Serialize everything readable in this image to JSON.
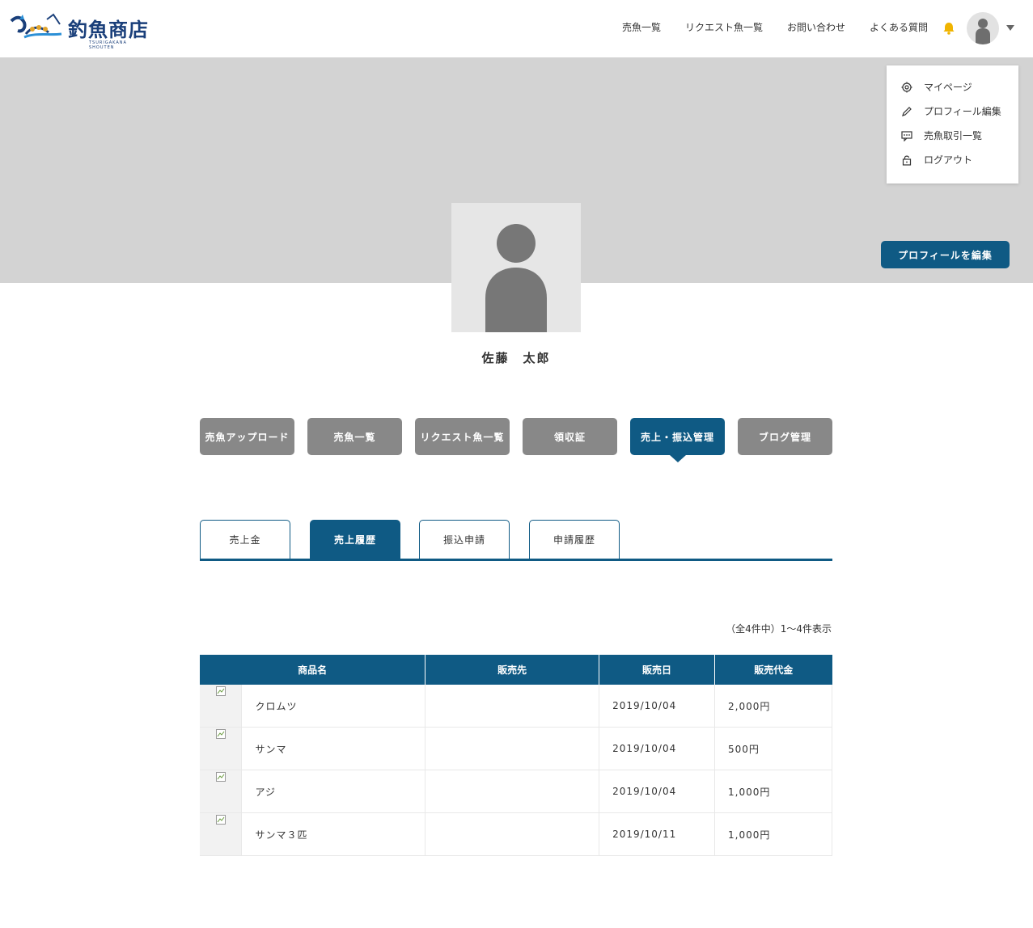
{
  "header": {
    "logo_text": "釣魚商店",
    "logo_sub": "TSURIGAKANA SHOUTEN",
    "nav": [
      "売魚一覧",
      "リクエスト魚一覧",
      "お問い合わせ",
      "よくある質問"
    ]
  },
  "user_menu": {
    "items": [
      "マイページ",
      "プロフィール編集",
      "売魚取引一覧",
      "ログアウト"
    ]
  },
  "profile": {
    "edit_button": "プロフィールを編集",
    "name": "佐藤　太郎"
  },
  "main_tabs": [
    "売魚アップロード",
    "売魚一覧",
    "リクエスト魚一覧",
    "領収証",
    "売上・振込管理",
    "ブログ管理"
  ],
  "main_tabs_active": "売上・振込管理",
  "sub_tabs": [
    "売上金",
    "売上履歴",
    "振込申請",
    "申請履歴"
  ],
  "sub_tabs_active": "売上履歴",
  "result_count": "（全4件中）1〜4件表示",
  "table": {
    "headers": [
      "商品名",
      "販売先",
      "販売日",
      "販売代金"
    ],
    "rows": [
      {
        "name": "クロムツ",
        "buyer": "",
        "date": "2019/10/04",
        "price": "2,000円"
      },
      {
        "name": "サンマ",
        "buyer": "",
        "date": "2019/10/04",
        "price": "500円"
      },
      {
        "name": "アジ",
        "buyer": "",
        "date": "2019/10/04",
        "price": "1,000円"
      },
      {
        "name": "サンマ３匹",
        "buyer": "",
        "date": "2019/10/11",
        "price": "1,000円"
      }
    ]
  },
  "colors": {
    "accent": "#0f5a84",
    "tab_inactive": "#888888",
    "banner": "#d3d3d3",
    "bell": "#f0b400"
  },
  "icons": [
    "logo-wave-icon",
    "bell-icon",
    "user-avatar-icon",
    "caret-down-icon",
    "gear-icon",
    "pencil-icon",
    "chat-icon",
    "lock-icon",
    "broken-image-icon"
  ]
}
